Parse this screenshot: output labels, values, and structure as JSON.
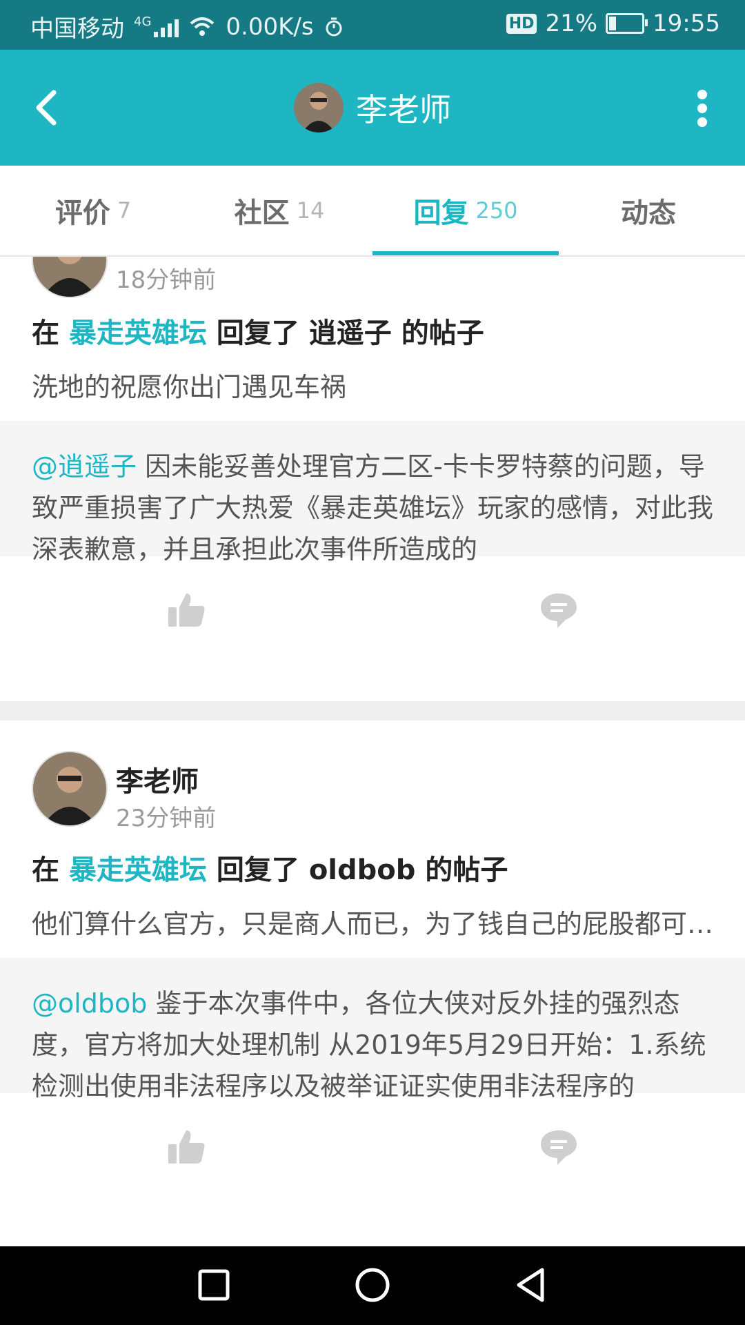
{
  "status_bar": {
    "carrier": "中国移动",
    "network": "4G",
    "speed": "0.00K/s",
    "hd": "HD",
    "battery": "21%",
    "battery_level": 0.21,
    "time": "19:55"
  },
  "header": {
    "title": "李老师",
    "back_icon": "back-arrow-icon",
    "more_icon": "more-vertical-icon"
  },
  "tabs": [
    {
      "label": "评价",
      "count": "7"
    },
    {
      "label": "社区",
      "count": "14"
    },
    {
      "label": "回复",
      "count": "250",
      "active": true
    },
    {
      "label": "动态",
      "count": ""
    }
  ],
  "posts": [
    {
      "author": "",
      "time": "18分钟前",
      "prefix": "在",
      "forum": "暴走英雄坛",
      "mid": "回复了",
      "target": "逍遥子",
      "suffix": "的帖子",
      "reply": "洗地的祝愿你出门遇见车祸",
      "quote_mention": "@逍遥子",
      "quote_text": "因未能妥善处理官方二区-卡卡罗特蔡的问题，导致严重损害了广大热爱《暴走英雄坛》玩家的感情，对此我深表歉意，并且承担此次事件所造成的"
    },
    {
      "author": "李老师",
      "time": "23分钟前",
      "prefix": "在",
      "forum": "暴走英雄坛",
      "mid": "回复了",
      "target": "oldbob",
      "suffix": "的帖子",
      "reply": "他们算什么官方，只是商人而已，为了钱自己的屁股都可以不要",
      "quote_mention": "@oldbob",
      "quote_text": "鉴于本次事件中，各位大侠对反外挂的强烈态度，官方将加大处理机制 从2019年5月29日开始：1.系统检测出使用非法程序以及被举证证实使用非法程序的"
    }
  ],
  "colors": {
    "accent": "#1eb6c3",
    "status_bar": "#167a85"
  }
}
